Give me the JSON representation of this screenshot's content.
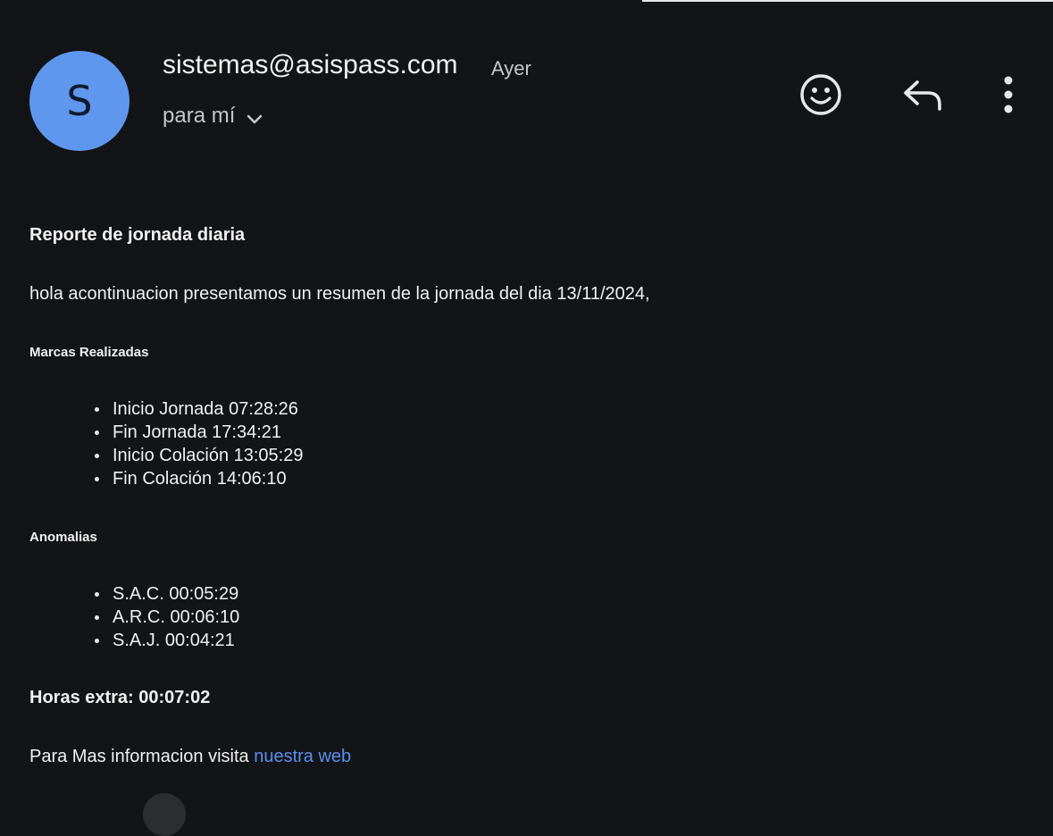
{
  "email": {
    "avatar_letter": "S",
    "avatar_color": "#5f97ee",
    "sender": "sistemas@asispass.com",
    "date": "Ayer",
    "recipient": "para mí",
    "actions": [
      "smiley-face-icon",
      "reply-icon",
      "more-vert-icon"
    ]
  },
  "content": {
    "title": "Reporte de jornada diaria",
    "intro": "hola acontinuacion presentamos un resumen de la jornada del dia 13/11/2024,",
    "marks_heading": "Marcas Realizadas",
    "marks": [
      "Inicio Jornada 07:28:26",
      "Fin Jornada 17:34:21",
      "Inicio Colación 13:05:29",
      "Fin Colación 14:06:10"
    ],
    "anomalies_heading": "Anomalias",
    "anomalies": [
      "S.A.C. 00:05:29",
      "A.R.C. 00:06:10",
      "S.A.J. 00:04:21"
    ],
    "overtime": "Horas extra: 00:07:02",
    "footer_text": "Para Mas informacion visita ",
    "footer_link": "nuestra web",
    "link_color": "#5b8ef0"
  }
}
